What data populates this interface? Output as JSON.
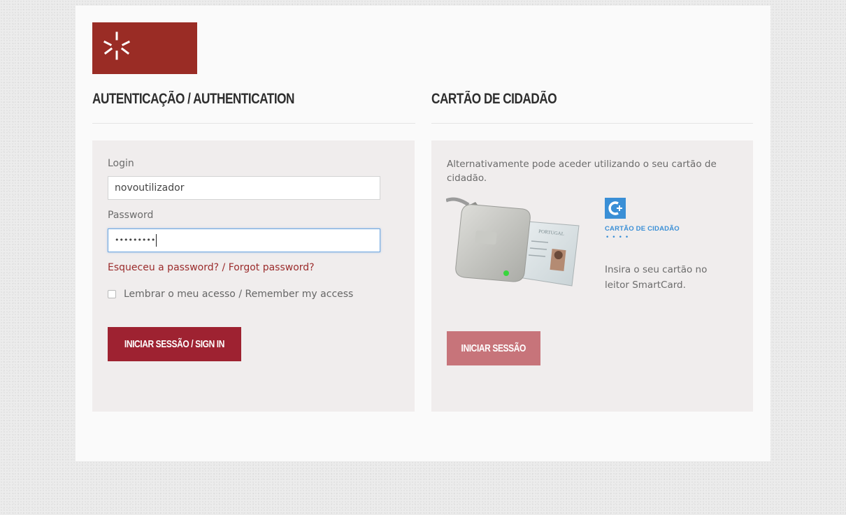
{
  "auth": {
    "heading": "AUTENTICAÇÃO / AUTHENTICATION",
    "login_label": "Login",
    "login_value": "novoutilizador",
    "password_label": "Password",
    "password_mask": "•••••••••",
    "forgot_link": "Esqueceu a password? / Forgot password?",
    "remember_label": "Lembrar o meu acesso / Remember my access",
    "remember_checked": false,
    "signin_button": "INICIAR SESSÃO / SIGN IN"
  },
  "citizen_card": {
    "heading": "CARTÃO DE CIDADÃO",
    "description": "Alternativamente pode aceder utilizando o seu cartão de cidadão.",
    "logo_text": "CARTÃO DE CIDADÃO",
    "logo_dots": "••••",
    "card_text": "PORTUGAL",
    "instructions": "Insira o seu cartão no leitor SmartCard.",
    "signin_button": "INICIAR SESSÃO"
  },
  "colors": {
    "brand": "#9a2c25",
    "primary_button": "#9e2231",
    "disabled_button": "#c7747a",
    "link": "#9b2c2c",
    "cc_blue": "#3a8fd6"
  }
}
